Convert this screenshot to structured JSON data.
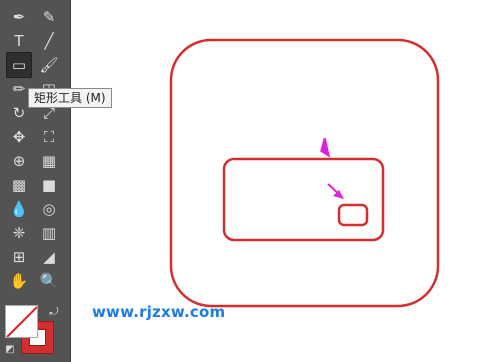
{
  "tooltip": {
    "text": "矩形工具 (M)"
  },
  "tools": [
    {
      "name": "pen-tool",
      "glyph": "✒"
    },
    {
      "name": "curvature-tool",
      "glyph": "✎"
    },
    {
      "name": "type-tool",
      "glyph": "T"
    },
    {
      "name": "line-segment-tool",
      "glyph": "╱"
    },
    {
      "name": "rectangle-tool",
      "glyph": "▭"
    },
    {
      "name": "paintbrush-tool",
      "glyph": "🖌"
    },
    {
      "name": "pencil-tool",
      "glyph": "✏"
    },
    {
      "name": "eraser-tool",
      "glyph": "◫"
    },
    {
      "name": "rotate-tool",
      "glyph": "↻"
    },
    {
      "name": "scale-tool",
      "glyph": "⤢"
    },
    {
      "name": "puppet-warp-tool",
      "glyph": "✥"
    },
    {
      "name": "free-transform-tool",
      "glyph": "⛶"
    },
    {
      "name": "shape-builder-tool",
      "glyph": "⊕"
    },
    {
      "name": "perspective-grid-tool",
      "glyph": "▦"
    },
    {
      "name": "mesh-tool",
      "glyph": "▩"
    },
    {
      "name": "gradient-tool",
      "glyph": "■"
    },
    {
      "name": "eyedropper-tool",
      "glyph": "💧"
    },
    {
      "name": "blend-tool",
      "glyph": "◎"
    },
    {
      "name": "symbol-sprayer-tool",
      "glyph": "❈"
    },
    {
      "name": "column-graph-tool",
      "glyph": "▥"
    },
    {
      "name": "artboard-tool",
      "glyph": "⊞"
    },
    {
      "name": "slice-tool",
      "glyph": "◢"
    },
    {
      "name": "hand-tool",
      "glyph": "✋"
    },
    {
      "name": "zoom-tool",
      "glyph": "🔍"
    }
  ],
  "colors": {
    "stroke": "#d32f2f",
    "fill": "#ffffff",
    "arrow": "#e020e0",
    "toolbar": "#535353"
  },
  "watermark": {
    "text": "www.rjzxw.com"
  }
}
